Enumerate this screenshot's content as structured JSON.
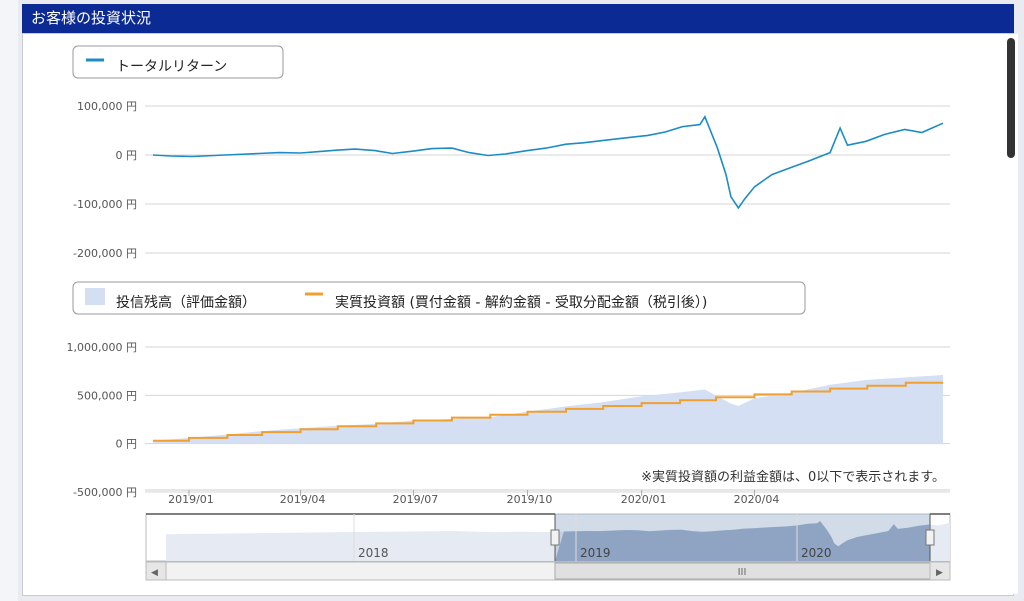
{
  "header": {
    "title": "お客様の投資状況"
  },
  "colors": {
    "header_bg": "#0c2a93",
    "return_line": "#1d8cc4",
    "invested_line": "#f0a030",
    "balance_area": "#d4dff3",
    "navigator_area": "#9bb0cc"
  },
  "chart_data": [
    {
      "type": "line",
      "legend": [
        "トータルリターン"
      ],
      "y_ticks": [
        "100,000 円",
        "0 円",
        "-100,000 円",
        "-200,000 円"
      ],
      "ylim": [
        -200000,
        100000
      ],
      "series": [
        {
          "name": "トータルリターン",
          "x": [
            "2018/12/03",
            "2018/12/17",
            "2019/01/04",
            "2019/01/21",
            "2019/02/08",
            "2019/02/26",
            "2019/03/15",
            "2019/04/01",
            "2019/04/16",
            "2019/05/01",
            "2019/05/15",
            "2019/05/31",
            "2019/06/14",
            "2019/07/01",
            "2019/07/16",
            "2019/08/01",
            "2019/08/15",
            "2019/08/30",
            "2019/09/13",
            "2019/10/01",
            "2019/10/16",
            "2019/11/01",
            "2019/11/15",
            "2019/12/02",
            "2019/12/16",
            "2020/01/06",
            "2020/01/20",
            "2020/02/03",
            "2020/02/17",
            "2020/02/21",
            "2020/03/02",
            "2020/03/09",
            "2020/03/13",
            "2020/03/19",
            "2020/03/24",
            "2020/04/01",
            "2020/04/15",
            "2020/05/01",
            "2020/05/15",
            "2020/06/01",
            "2020/06/09",
            "2020/06/15",
            "2020/06/30",
            "2020/07/15",
            "2020/07/31",
            "2020/08/14",
            "2020/08/31"
          ],
          "values": [
            0,
            -2000,
            -3000,
            -1000,
            1000,
            3000,
            5000,
            4000,
            7000,
            10000,
            12000,
            9000,
            3000,
            8000,
            13000,
            14000,
            5000,
            -1000,
            2000,
            9000,
            14000,
            22000,
            25000,
            30000,
            34000,
            40000,
            47000,
            58000,
            62000,
            78000,
            15000,
            -40000,
            -85000,
            -108000,
            -90000,
            -65000,
            -40000,
            -25000,
            -12000,
            5000,
            55000,
            20000,
            28000,
            42000,
            52000,
            46000,
            65000
          ]
        }
      ]
    },
    {
      "type": "area",
      "legend": [
        "投信残高（評価金額）",
        "実質投資額 (買付金額 - 解約金額 - 受取分配金額（税引後）)"
      ],
      "y_ticks": [
        "1,000,000 円",
        "500,000 円",
        "0 円",
        "-500,000 円"
      ],
      "ylim": [
        -500000,
        1000000
      ],
      "x_ticks": [
        "2019/01",
        "2019/04",
        "2019/07",
        "2019/10",
        "2020/01",
        "2020/04"
      ],
      "note": "※実質投資額の利益金額は、0以下で表示されます。",
      "series": [
        {
          "name": "投信残高（評価金額）",
          "x": [
            "2018/12/03",
            "2019/01/01",
            "2019/02/01",
            "2019/03/01",
            "2019/04/01",
            "2019/05/01",
            "2019/06/01",
            "2019/07/01",
            "2019/08/01",
            "2019/09/01",
            "2019/10/01",
            "2019/11/01",
            "2019/12/01",
            "2020/01/01",
            "2020/02/01",
            "2020/02/21",
            "2020/03/13",
            "2020/03/19",
            "2020/04/01",
            "2020/05/01",
            "2020/06/01",
            "2020/07/01",
            "2020/08/31"
          ],
          "values": [
            30000,
            60000,
            95000,
            130000,
            160000,
            185000,
            205000,
            240000,
            255000,
            275000,
            330000,
            385000,
            430000,
            490000,
            530000,
            560000,
            415000,
            390000,
            470000,
            525000,
            610000,
            660000,
            710000
          ]
        },
        {
          "name": "実質投資額 (買付金額 - 解約金額 - 受取分配金額（税引後）)",
          "x": [
            "2018/12/03",
            "2019/01/01",
            "2019/02/01",
            "2019/03/01",
            "2019/04/01",
            "2019/05/01",
            "2019/06/01",
            "2019/07/01",
            "2019/08/01",
            "2019/09/01",
            "2019/10/01",
            "2019/11/01",
            "2019/12/01",
            "2020/01/01",
            "2020/02/01",
            "2020/03/01",
            "2020/04/01",
            "2020/05/01",
            "2020/06/01",
            "2020/07/01",
            "2020/08/01",
            "2020/08/31"
          ],
          "values": [
            30000,
            60000,
            90000,
            120000,
            150000,
            180000,
            210000,
            240000,
            270000,
            300000,
            330000,
            360000,
            390000,
            420000,
            450000,
            480000,
            510000,
            540000,
            570000,
            600000,
            630000,
            630000
          ]
        }
      ]
    }
  ],
  "navigator": {
    "labels": [
      "2018",
      "2019",
      "2020"
    ],
    "scroll_left": "◀",
    "scroll_right": "▶",
    "thumb_grip": "III"
  }
}
